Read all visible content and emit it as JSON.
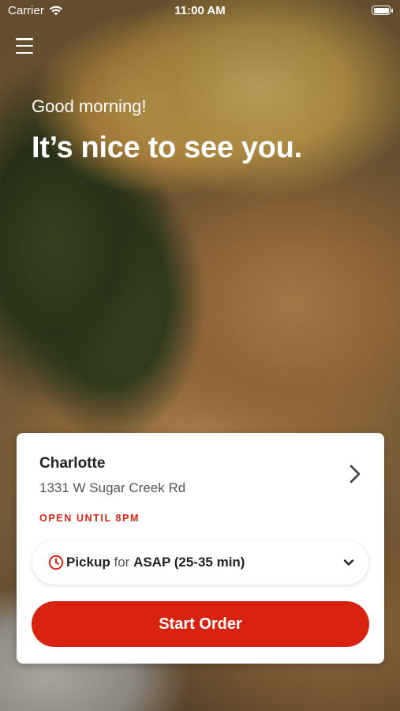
{
  "status_bar": {
    "carrier": "Carrier",
    "time": "11:00 AM",
    "icons": [
      "wifi-icon",
      "battery-icon"
    ]
  },
  "header": {
    "menu_icon": "hamburger-menu-icon",
    "greeting": "Good morning!",
    "headline": "It’s nice to see you."
  },
  "location": {
    "name": "Charlotte",
    "address": "1331 W Sugar Creek Rd",
    "status": "OPEN UNTIL 8PM",
    "chevron_icon": "chevron-right-icon"
  },
  "order_mode": {
    "icon": "clock-icon",
    "mode": "Pickup",
    "connector": "for",
    "time": "ASAP (25-35 min)",
    "dropdown_icon": "chevron-down-icon"
  },
  "actions": {
    "start_order": "Start Order"
  },
  "colors": {
    "accent": "#d82310",
    "status": "#d62410",
    "card_bg": "#ffffff",
    "text_primary": "#222222",
    "text_secondary": "#555555"
  }
}
